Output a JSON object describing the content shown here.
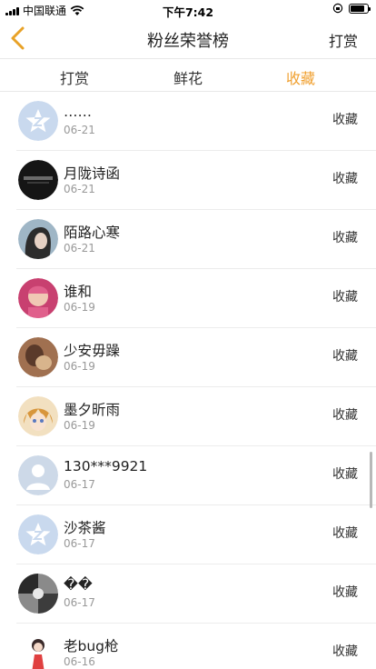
{
  "status_bar": {
    "carrier": "中国联通",
    "time": "下午7:42"
  },
  "nav": {
    "title": "粉丝荣誉榜",
    "right_action": "打赏"
  },
  "tabs": [
    {
      "label": "打赏",
      "active": false
    },
    {
      "label": "鲜花",
      "active": false
    },
    {
      "label": "收藏",
      "active": true
    }
  ],
  "accent_color": "#f0a030",
  "fans": [
    {
      "name": "……",
      "date": "06-21",
      "action": "收藏",
      "avatar": "default-star-avatar"
    },
    {
      "name": "月陇诗函",
      "date": "06-21",
      "action": "收藏",
      "avatar": "dark-photo-avatar"
    },
    {
      "name": "陌路心寒",
      "date": "06-21",
      "action": "收藏",
      "avatar": "portrait-photo-avatar"
    },
    {
      "name": "谁和",
      "date": "06-19",
      "action": "收藏",
      "avatar": "baby-photo-avatar"
    },
    {
      "name": "少安毋躁",
      "date": "06-19",
      "action": "收藏",
      "avatar": "photo-avatar"
    },
    {
      "name": "墨夕昕雨",
      "date": "06-19",
      "action": "收藏",
      "avatar": "anime-avatar"
    },
    {
      "name": "130***9921",
      "date": "06-17",
      "action": "收藏",
      "avatar": "default-person-avatar"
    },
    {
      "name": "沙茶酱",
      "date": "06-17",
      "action": "收藏",
      "avatar": "default-star-avatar"
    },
    {
      "name": "��",
      "date": "06-17",
      "action": "收藏",
      "avatar": "bw-photo-avatar"
    },
    {
      "name": "老bug枪",
      "date": "06-16",
      "action": "收藏",
      "avatar": "cartoon-girl-avatar"
    }
  ]
}
